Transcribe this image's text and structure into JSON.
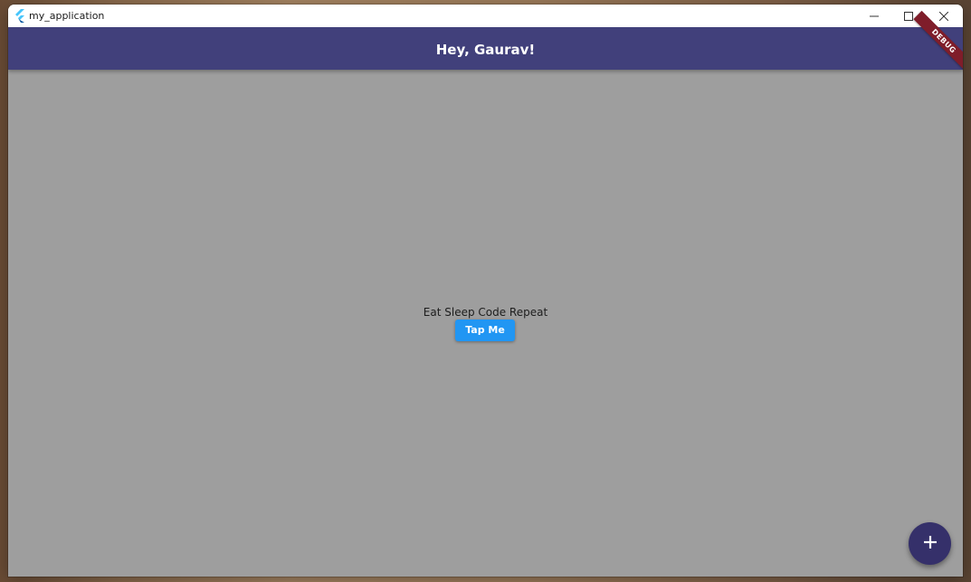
{
  "window": {
    "title": "my_application",
    "app_icon": "flutter-icon",
    "controls": {
      "minimize_icon": "minimize-icon",
      "maximize_icon": "maximize-icon",
      "close_icon": "close-icon"
    }
  },
  "appbar": {
    "title": "Hey, Gaurav!",
    "background_color": "#41407b",
    "debug_banner": "DEBUG",
    "debug_banner_color": "#7f1d2a"
  },
  "body": {
    "background_color": "#9e9e9e",
    "text": "Eat Sleep Code Repeat",
    "button_label": "Tap Me",
    "button_color": "#2196f3"
  },
  "fab": {
    "icon": "plus-icon",
    "color": "#35306a"
  }
}
